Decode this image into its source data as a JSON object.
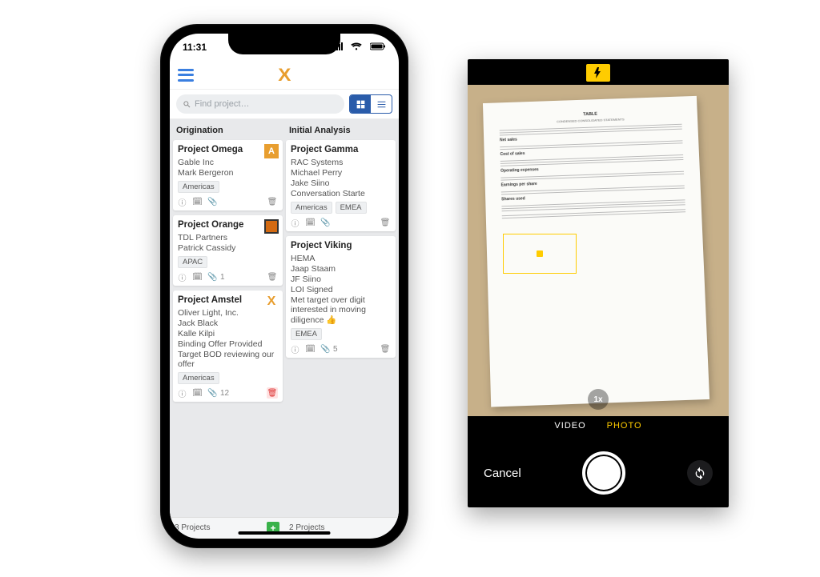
{
  "status": {
    "time": "11:31"
  },
  "search": {
    "placeholder": "Find project…"
  },
  "columns": [
    {
      "title": "Origination",
      "footer_count": "3 Projects",
      "cards": [
        {
          "title": "Project Omega",
          "badge": "A",
          "lines": [
            "Gable Inc",
            "Mark Bergeron"
          ],
          "tags": [
            "Americas"
          ],
          "attach_count": ""
        },
        {
          "title": "Project Orange",
          "badge": "",
          "lines": [
            "TDL Partners",
            "Patrick Cassidy"
          ],
          "tags": [
            "APAC"
          ],
          "attach_count": "1"
        },
        {
          "title": "Project Amstel",
          "badge": "X",
          "lines": [
            "Oliver Light, Inc.",
            "Jack Black",
            "Kalle Kilpi",
            "Binding Offer Provided",
            "Target BOD reviewing our offer"
          ],
          "tags": [
            "Americas"
          ],
          "attach_count": "12"
        }
      ]
    },
    {
      "title": "Initial Analysis",
      "footer_count": "2 Projects",
      "cards": [
        {
          "title": "Project Gamma",
          "badge": "",
          "lines": [
            "RAC Systems",
            "Michael Perry",
            "Jake Siino",
            "Conversation Starte"
          ],
          "tags": [
            "Americas",
            "EMEA"
          ],
          "attach_count": ""
        },
        {
          "title": "Project Viking",
          "badge": "",
          "lines": [
            "HEMA",
            "Jaap Staam",
            "JF Siino",
            "LOI Signed",
            "Met target over digit interested in moving diligence 👍"
          ],
          "tags": [
            "EMEA"
          ],
          "attach_count": "5"
        }
      ]
    }
  ],
  "camera": {
    "modes": {
      "video": "VIDEO",
      "photo": "PHOTO"
    },
    "zoom": "1x",
    "cancel": "Cancel"
  }
}
